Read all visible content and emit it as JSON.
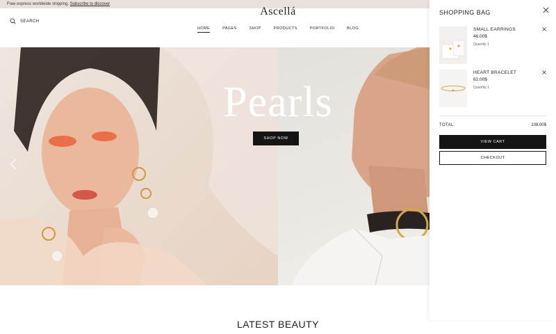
{
  "announcement": {
    "text": "Free express worldwide shipping.",
    "link": "Subscribe to discover"
  },
  "header": {
    "search_label": "SEARCH",
    "logo": "Ascellá",
    "nav": [
      {
        "label": "HOME",
        "active": true
      },
      {
        "label": "PAGES",
        "active": false
      },
      {
        "label": "SHOP",
        "active": false
      },
      {
        "label": "PRODUCTS",
        "active": false
      },
      {
        "label": "PORTFOLIO",
        "active": false
      },
      {
        "label": "BLOG",
        "active": false
      }
    ]
  },
  "hero": {
    "title": "Pearls",
    "button": "SHOP NOW"
  },
  "section": {
    "title": "LATEST BEAUTY"
  },
  "bag": {
    "title": "SHOPPING BAG",
    "items": [
      {
        "name": "SMALL EARRINGS",
        "price": "46.00$",
        "quantity": "Quantity 1"
      },
      {
        "name": "HEART BRACELET",
        "price": "62.00$",
        "quantity": "Quantity 1"
      }
    ],
    "total_label": "TOTAL:",
    "total_value": "108.00$",
    "view_cart": "VIEW CART",
    "checkout": "CHECKOUT"
  },
  "colors": {
    "announcement_bg": "#e9e1dd",
    "button_dark": "#141414",
    "gold": "#d1a94a"
  },
  "icons": [
    "search-icon",
    "close-icon",
    "remove-icon",
    "chevron-left-icon"
  ]
}
